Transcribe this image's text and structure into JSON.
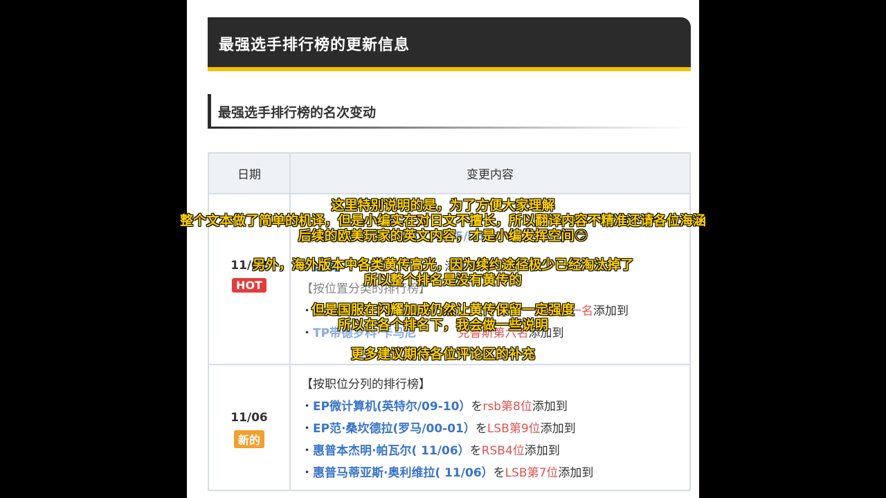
{
  "banner": {
    "title": "最强选手排行榜的更新信息"
  },
  "section": {
    "title": "最强选手排行榜的名次变动"
  },
  "table": {
    "headers": {
      "date": "日期",
      "content": "变更内容"
    },
    "row1": {
      "date": "11/02",
      "badge": "HOT",
      "lines": [
        {
          "pre": "・",
          "blue": "EP里皮卡尔·梅西(2016/05/06)",
          "mid": "を",
          "red": "RW第4",
          "post": "添加到"
        },
        {
          "pre": "・",
          "blue": "让·路",
          "mid": "",
          "red": "",
          "post": "添加到"
        },
        {
          "pre": "【",
          "blue": "",
          "mid": "按位置分类的排行榜",
          "red": "",
          "post": "】"
        },
        {
          "pre": "・",
          "blue": "",
          "mid": "",
          "red": "收器第一名",
          "post": "添加到"
        },
        {
          "pre": "・",
          "blue": "TP带德罗科·卡马尼",
          "mid": "",
          "red": "克鲁斯第六名",
          "post": "添加到"
        }
      ]
    },
    "row2": {
      "date": "11/06",
      "badge": "新的",
      "heading": "【按职位分列的排行榜】",
      "lines": [
        {
          "pre": "・",
          "blue": "EP微计算机(英特尔/09-10）",
          "mid": "を",
          "red": "rsb第8位",
          "post": "添加到"
        },
        {
          "pre": "・",
          "blue": "EP范·桑坎德拉(罗马/00-01）",
          "mid": "を",
          "red": "LSB第9位",
          "post": "添加到"
        },
        {
          "pre": "・",
          "blue": "惠普本杰明·帕瓦尔( 11/06）",
          "mid": "を",
          "red": "RSB4位",
          "post": "添加到"
        },
        {
          "pre": "・",
          "blue": "惠普马蒂亚斯·奥利维拉( 11/06）",
          "mid": "を",
          "red": "LSB第7位",
          "post": "添加到"
        }
      ]
    }
  },
  "subtitles": [
    "这里特别说明的是，为了方便大家理解",
    "整个文本做了简单的机译，但是小编实在对日文不擅长，所以翻译内容不精准还请各位海涵",
    "后续的欧美玩家的英文内容，才是小编发挥空间😏",
    "另外，海外版本中各类黄传高光，因为续约途径极少已经淘汰掉了",
    "所以整个排名是没有黄传的",
    "但是国服在闪耀加成仍然让黄传保留一定强度",
    "所以在各个排名下，我会做一些说明",
    "更多建议期待各位评论区的补充"
  ]
}
